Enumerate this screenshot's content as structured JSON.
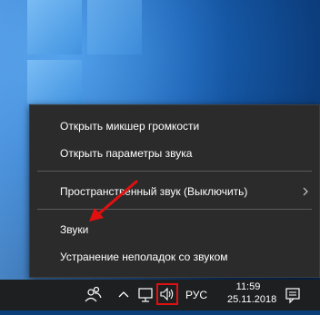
{
  "context_menu": {
    "items": [
      {
        "label": "Открыть микшер громкости",
        "has_submenu": false
      },
      {
        "label": "Открыть параметры звука",
        "has_submenu": false
      },
      {
        "label": "Пространственный звук (Выключить)",
        "has_submenu": true
      },
      {
        "label": "Звуки",
        "has_submenu": false
      },
      {
        "label": "Устранение неполадок со звуком",
        "has_submenu": false
      }
    ]
  },
  "taskbar": {
    "language": "РУС",
    "time": "11:59",
    "date": "25.11.2018",
    "icons": [
      "people-icon",
      "chevron-up-icon",
      "network-icon",
      "volume-icon",
      "action-center-icon"
    ]
  },
  "colors": {
    "menu_bg": "#2b2b2b",
    "highlight": "#e01010",
    "taskbar_bg": "#1d1f21"
  }
}
